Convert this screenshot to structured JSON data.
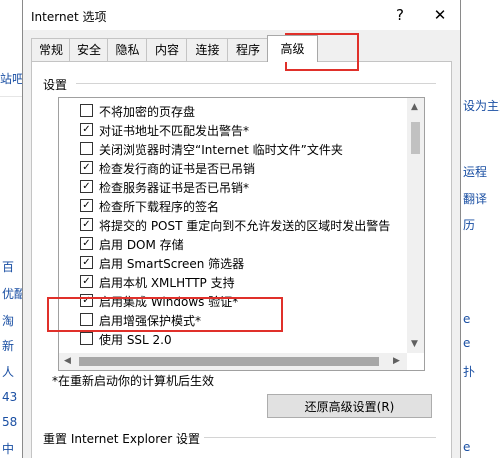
{
  "window": {
    "title": "Internet 选项",
    "help_label": "?",
    "close_label": "✕"
  },
  "tabs": [
    "常规",
    "安全",
    "隐私",
    "内容",
    "连接",
    "程序",
    "高级"
  ],
  "active_tab": "高级",
  "settings": {
    "group_label": "设置",
    "items": [
      {
        "label": "不将加密的页存盘",
        "checked": false
      },
      {
        "label": "对证书地址不匹配发出警告*",
        "checked": true
      },
      {
        "label": "关闭浏览器时清空“Internet 临时文件”文件夹",
        "checked": false
      },
      {
        "label": "检查发行商的证书是否已吊销",
        "checked": true
      },
      {
        "label": "检查服务器证书是否已吊销*",
        "checked": true
      },
      {
        "label": "检查所下载程序的签名",
        "checked": true
      },
      {
        "label": "将提交的 POST 重定向到不允许发送的区域时发出警告",
        "checked": true
      },
      {
        "label": "启用 DOM 存储",
        "checked": true
      },
      {
        "label": "启用 SmartScreen 筛选器",
        "checked": true
      },
      {
        "label": "启用本机 XMLHTTP 支持",
        "checked": true
      },
      {
        "label": "启用集成 Windows 验证*",
        "checked": true
      },
      {
        "label": "启用增强保护模式*",
        "checked": false
      },
      {
        "label": "使用 SSL 2.0",
        "checked": false
      }
    ],
    "restart_note": "*在重新启动你的计算机后生效",
    "restore_button": "还原高级设置(R)"
  },
  "reset": {
    "group_label": "重置 Internet Explorer 设置"
  },
  "background": {
    "left_texts": [
      "站吧",
      "百",
      "优酷",
      "淘",
      "新",
      "人",
      "43",
      "58",
      "中"
    ],
    "right_texts": [
      "设为主页",
      "运程",
      "翻译",
      "历",
      "e",
      "e",
      "扑",
      "e"
    ]
  }
}
